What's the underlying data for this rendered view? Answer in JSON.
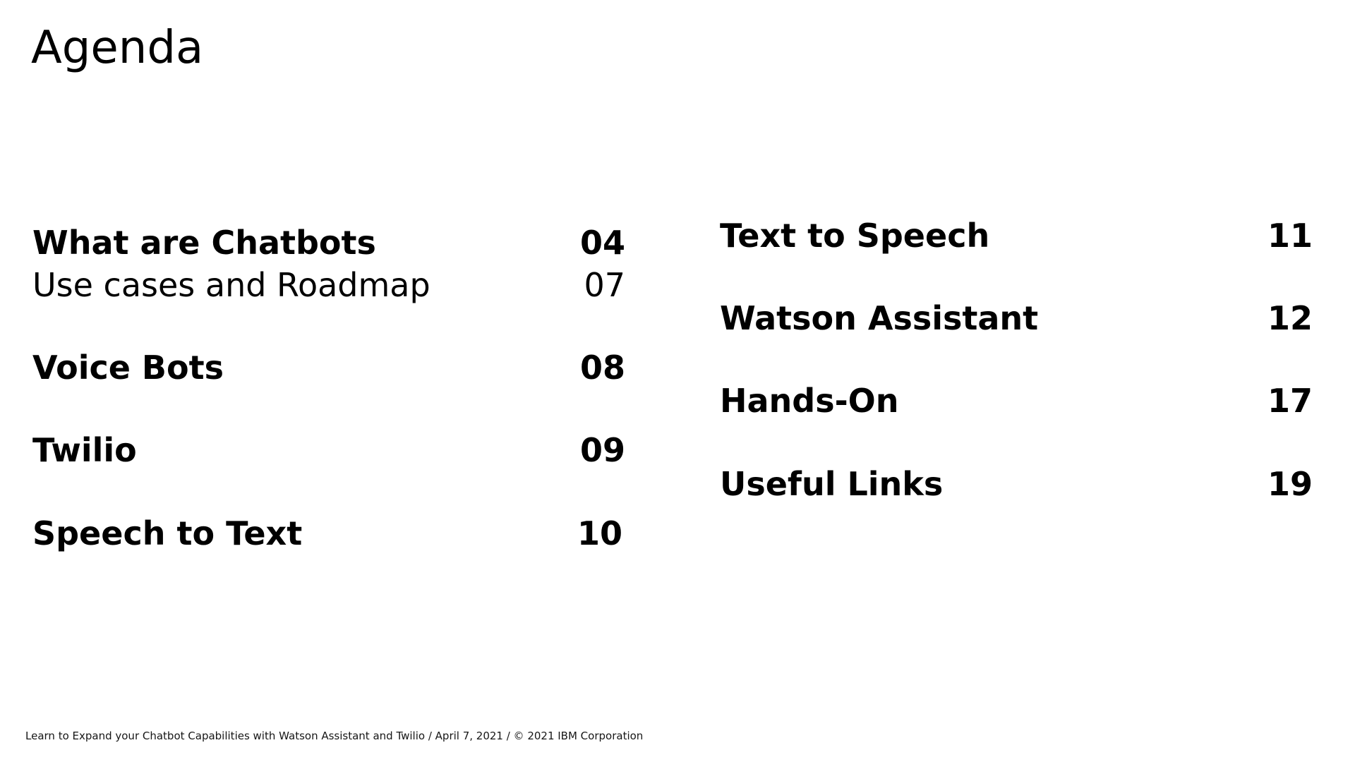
{
  "title": "Agenda",
  "left_column": [
    {
      "label": "What are Chatbots",
      "page": "04",
      "weight": "bold"
    },
    {
      "label": "Use cases and Roadmap",
      "page": "07",
      "weight": "regular"
    },
    {
      "label": "Voice Bots",
      "page": "08",
      "weight": "bold"
    },
    {
      "label": "Twilio",
      "page": "09",
      "weight": "bold"
    },
    {
      "label": "Speech to Text",
      "page": "10",
      "weight": "bold"
    }
  ],
  "right_column": [
    {
      "label": "Text to Speech",
      "page": "11",
      "weight": "bold"
    },
    {
      "label": "Watson Assistant",
      "page": "12",
      "weight": "bold"
    },
    {
      "label": "Hands-On",
      "page": "17",
      "weight": "bold"
    },
    {
      "label": "Useful Links",
      "page": "19",
      "weight": "bold"
    }
  ],
  "footer": "Learn to Expand your Chatbot Capabilities with Watson Assistant and Twilio / April 7, 2021 / © 2021 IBM Corporation"
}
